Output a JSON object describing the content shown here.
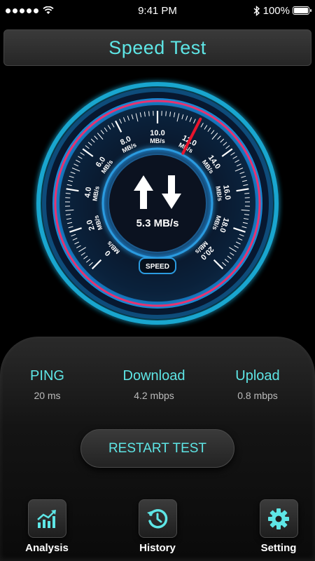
{
  "status_bar": {
    "time": "9:41 PM",
    "battery": "100%"
  },
  "header": {
    "title": "Speed Test"
  },
  "gauge": {
    "center_value": "5.3 MB/s",
    "badge": "SPEED",
    "needle_value": 12.0,
    "tick_labels": [
      {
        "value": "0",
        "unit": "MB/s"
      },
      {
        "value": "2.0",
        "unit": "MB/s"
      },
      {
        "value": "4.0",
        "unit": "MB/s"
      },
      {
        "value": "6.0",
        "unit": "MB/s"
      },
      {
        "value": "8.0",
        "unit": "MB/s"
      },
      {
        "value": "10.0",
        "unit": "MB/s"
      },
      {
        "value": "12.0",
        "unit": "MB/s"
      },
      {
        "value": "14.0",
        "unit": "MB/s"
      },
      {
        "value": "16.0",
        "unit": "MB/s"
      },
      {
        "value": "18.0",
        "unit": "MB/s"
      },
      {
        "value": "20.0",
        "unit": "MB/s"
      }
    ],
    "colors": {
      "ring": "#1fb8e6",
      "accent": "#e8326f",
      "needle": "#e8142c"
    }
  },
  "stats": {
    "ping": {
      "label": "PING",
      "value": "20 ms"
    },
    "download": {
      "label": "Download",
      "value": "4.2 mbps"
    },
    "upload": {
      "label": "Upload",
      "value": "0.8 mbps"
    }
  },
  "actions": {
    "restart_label": "RESTART TEST"
  },
  "nav": {
    "analysis": {
      "label": "Analysis",
      "icon": "chart-icon"
    },
    "history": {
      "label": "History",
      "icon": "history-icon"
    },
    "setting": {
      "label": "Setting",
      "icon": "gear-icon"
    }
  },
  "theme": {
    "accent": "#5ee6e6"
  }
}
